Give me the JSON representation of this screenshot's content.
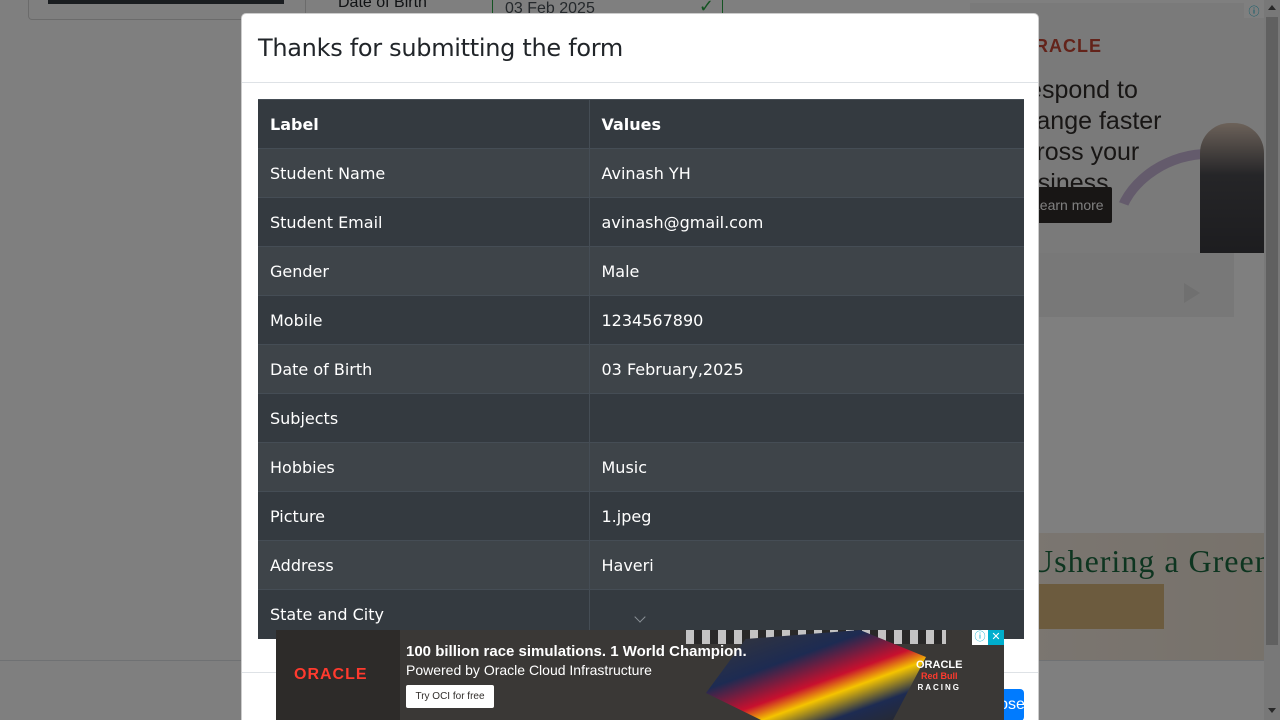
{
  "background": {
    "dob_label": "Date of Birth",
    "dob_value": "03 Feb 2025"
  },
  "ad_right_top": {
    "brand": "ORACLE",
    "headline": "Respond to change faster across your business",
    "cta": "Learn more"
  },
  "ad_right_bottom": {
    "text": "Ushering a Green Era"
  },
  "modal": {
    "title": "Thanks for submitting the form",
    "table": {
      "headers": [
        "Label",
        "Values"
      ],
      "rows": [
        {
          "label": "Student Name",
          "value": "Avinash YH"
        },
        {
          "label": "Student Email",
          "value": "avinash@gmail.com"
        },
        {
          "label": "Gender",
          "value": "Male"
        },
        {
          "label": "Mobile",
          "value": "1234567890"
        },
        {
          "label": "Date of Birth",
          "value": "03 February,2025"
        },
        {
          "label": "Subjects",
          "value": ""
        },
        {
          "label": "Hobbies",
          "value": "Music"
        },
        {
          "label": "Picture",
          "value": "1.jpeg"
        },
        {
          "label": "Address",
          "value": "Haveri"
        },
        {
          "label": "State and City",
          "value": ""
        }
      ]
    },
    "close_label": "Close"
  },
  "ad_bottom": {
    "brand": "ORACLE",
    "headline": "100 billion race simulations. 1 World Champion.",
    "subline": "Powered by Oracle Cloud Infrastructure",
    "cta": "Try OCI for free",
    "partner_top": "ORACLE",
    "partner_mid": "Red Bull",
    "partner_bottom": "RACING"
  },
  "colors": {
    "table_bg": "#343a40",
    "primary": "#007bff",
    "success": "#28a745"
  }
}
